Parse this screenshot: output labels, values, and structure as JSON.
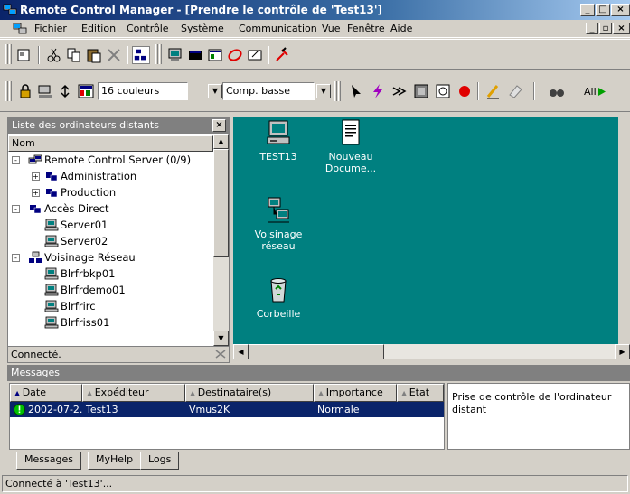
{
  "window": {
    "title": "Remote Control Manager - [Prendre le contrôle de 'Test13']"
  },
  "menu": [
    "Fichier",
    "Edition",
    "Contrôle",
    "Système",
    "Communication",
    "Vue",
    "Fenêtre",
    "Aide"
  ],
  "toolbar2": {
    "colors_value": "16 couleurs",
    "compression_value": "Comp. basse",
    "all_label": "All"
  },
  "left_panel": {
    "title": "Liste des ordinateurs distants",
    "column": "Nom",
    "status": "Connecté.",
    "tree": [
      {
        "label": "Remote Control Server (0/9)",
        "level": 0,
        "expand": "-",
        "icon": "server-group-icon"
      },
      {
        "label": "Administration",
        "level": 1,
        "expand": "+",
        "icon": "group-icon"
      },
      {
        "label": "Production",
        "level": 1,
        "expand": "+",
        "icon": "group-icon"
      },
      {
        "label": "Accès Direct",
        "level": 0,
        "expand": "-",
        "icon": "group-icon"
      },
      {
        "label": "Server01",
        "level": 1,
        "expand": "",
        "icon": "computer-icon"
      },
      {
        "label": "Server02",
        "level": 1,
        "expand": "",
        "icon": "computer-icon"
      },
      {
        "label": "Voisinage Réseau",
        "level": 0,
        "expand": "-",
        "icon": "network-icon"
      },
      {
        "label": "Blrfrbkp01",
        "level": 1,
        "expand": "",
        "icon": "computer-icon"
      },
      {
        "label": "Blrfrdemo01",
        "level": 1,
        "expand": "",
        "icon": "computer-icon"
      },
      {
        "label": "Blrfrirc",
        "level": 1,
        "expand": "",
        "icon": "computer-icon"
      },
      {
        "label": "Blrfriss01",
        "level": 1,
        "expand": "",
        "icon": "computer-icon"
      }
    ]
  },
  "desktop": {
    "background": "#008080",
    "icons": [
      {
        "label": "TEST13",
        "icon": "my-computer-icon"
      },
      {
        "label": "Nouveau Docume...",
        "icon": "document-icon"
      },
      {
        "label": "Voisinage réseau",
        "icon": "network-neighborhood-icon"
      },
      {
        "label": "Corbeille",
        "icon": "recycle-bin-icon"
      }
    ]
  },
  "messages": {
    "title": "Messages",
    "columns": [
      "Date",
      "Expéditeur",
      "Destinataire(s)",
      "Importance",
      "Etat"
    ],
    "rows": [
      {
        "date": "2002-07-2...",
        "sender": "Test13",
        "recipient": "Vmus2K",
        "importance": "Normale",
        "state": ""
      }
    ],
    "detail": "Prise de contrôle de l'ordinateur distant",
    "tabs": [
      "Messages",
      "MyHelp",
      "Logs"
    ]
  },
  "statusbar": "Connecté à 'Test13'...",
  "colors": {
    "title_start": "#0a246a",
    "title_end": "#a6caf0",
    "selection": "#0a246a",
    "desktop": "#008080"
  }
}
